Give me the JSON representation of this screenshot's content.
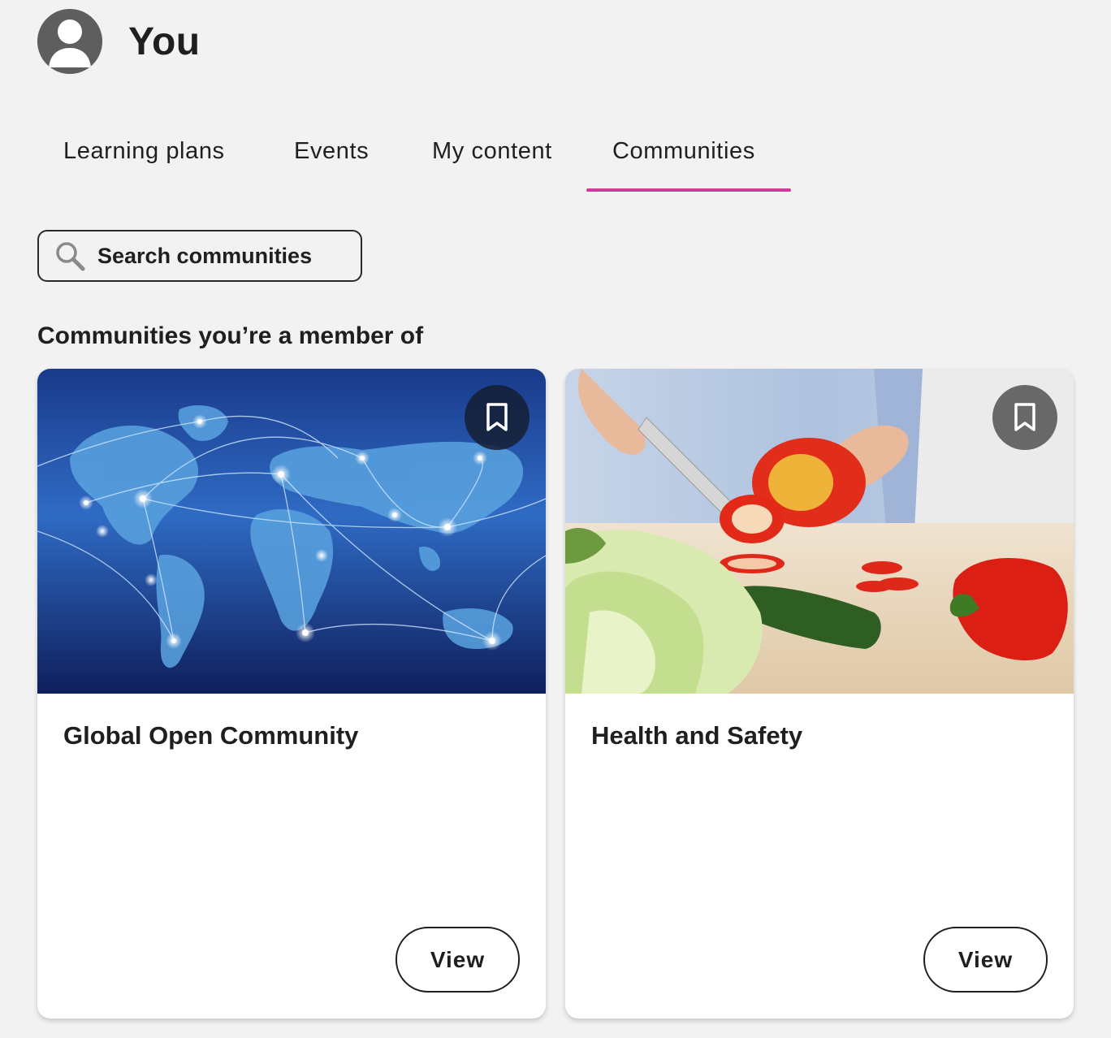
{
  "profile": {
    "name": "You",
    "avatar_icon": "user-avatar-icon"
  },
  "tabs": [
    {
      "label": "Learning plans",
      "active": false
    },
    {
      "label": "Events",
      "active": false
    },
    {
      "label": "My content",
      "active": false
    },
    {
      "label": "Communities",
      "active": true
    }
  ],
  "search": {
    "placeholder": "Search communities",
    "value": "",
    "icon": "search-icon"
  },
  "section": {
    "title": "Communities you’re a member of"
  },
  "communities": [
    {
      "title": "Global Open Community",
      "image": "world-network-map",
      "bookmark_icon": "bookmark-icon",
      "action_label": "View"
    },
    {
      "title": "Health and Safety",
      "image": "cutting-vegetables",
      "bookmark_icon": "bookmark-icon",
      "action_label": "View"
    }
  ],
  "colors": {
    "accent": "#d03b95",
    "background": "#f2f2f2",
    "text": "#1f1f1f"
  }
}
